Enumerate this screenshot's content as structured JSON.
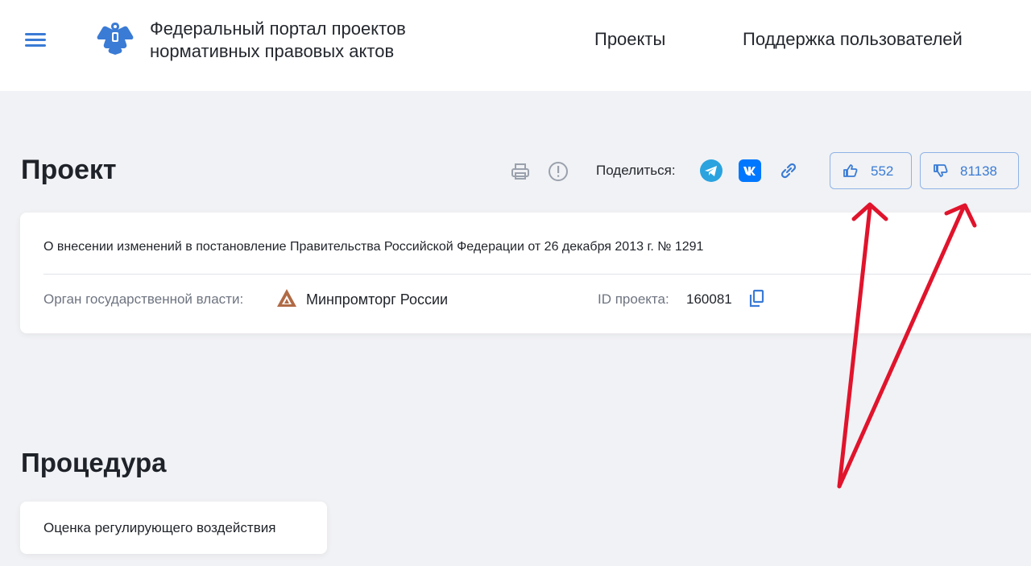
{
  "header": {
    "title_line1": "Федеральный портал проектов",
    "title_line2": "нормативных правовых актов",
    "nav": [
      "Проекты",
      "Поддержка пользователей"
    ]
  },
  "project": {
    "heading": "Проект",
    "share_label": "Поделиться:",
    "likes": "552",
    "dislikes": "81138",
    "title": "О внесении изменений в постановление Правительства Российской Федерации от 26 декабря 2013 г. № 1291",
    "org_label": "Орган государственной власти:",
    "org_name": "Минпромторг России",
    "id_label": "ID проекта:",
    "id_value": "160081"
  },
  "procedure": {
    "heading": "Процедура",
    "item": "Оценка регулирующего воздействия"
  },
  "icons": {
    "menu": "hamburger-menu-icon",
    "print": "print-icon",
    "report": "exclamation-circle-icon",
    "telegram": "telegram-icon",
    "vk": "vk-icon",
    "link": "link-icon",
    "like": "thumbs-up-icon",
    "dislike": "thumbs-down-icon",
    "copy": "copy-icon"
  },
  "colors": {
    "accent": "#3a7bd5",
    "annotation_arrow": "#e0142c",
    "telegram": "#2aa3df",
    "vk": "#0077ff",
    "org_logo": "#b06a45"
  }
}
